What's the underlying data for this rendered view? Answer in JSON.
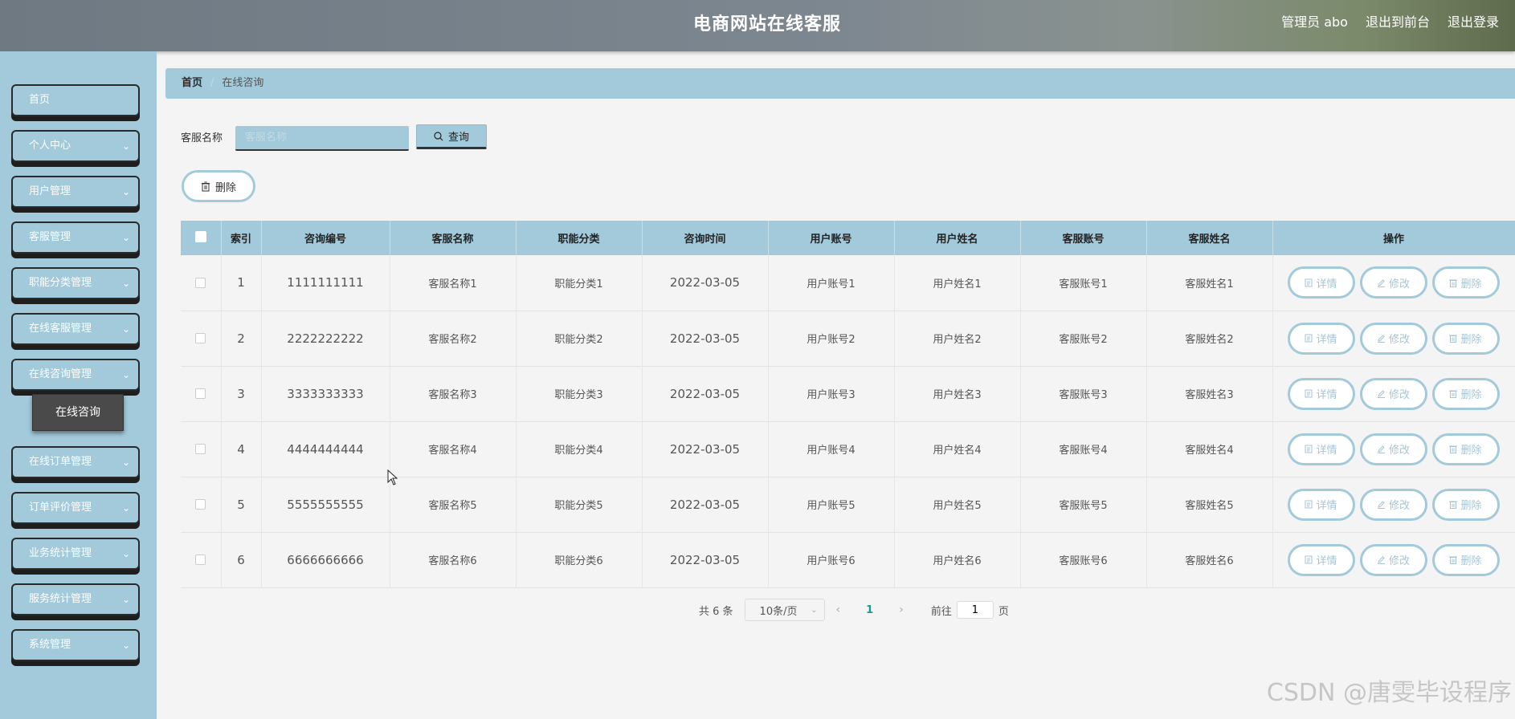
{
  "header": {
    "title": "电商网站在线客服",
    "admin": "管理员 abo",
    "front": "退出到前台",
    "logout": "退出登录"
  },
  "sidebar": {
    "items": [
      {
        "label": "首页",
        "chevron": false
      },
      {
        "label": "个人中心",
        "chevron": true
      },
      {
        "label": "用户管理",
        "chevron": true
      },
      {
        "label": "客服管理",
        "chevron": true
      },
      {
        "label": "职能分类管理",
        "chevron": true
      },
      {
        "label": "在线客服管理",
        "chevron": true
      },
      {
        "label": "在线咨询管理",
        "chevron": true
      },
      {
        "label": "在线订单管理",
        "chevron": true
      },
      {
        "label": "订单评价管理",
        "chevron": true
      },
      {
        "label": "业务统计管理",
        "chevron": true
      },
      {
        "label": "服务统计管理",
        "chevron": true
      },
      {
        "label": "系统管理",
        "chevron": true
      }
    ],
    "active_sub": "在线咨询"
  },
  "breadcrumb": {
    "home": "首页",
    "sep": "/",
    "current": "在线咨询"
  },
  "search": {
    "label": "客服名称",
    "placeholder": "客服名称",
    "button": "查询"
  },
  "toolbar": {
    "delete": "删除"
  },
  "table": {
    "headers": [
      "索引",
      "咨询编号",
      "客服名称",
      "职能分类",
      "咨询时间",
      "用户账号",
      "用户姓名",
      "客服账号",
      "客服姓名",
      "操作"
    ],
    "rows": [
      [
        "1",
        "1111111111",
        "客服名称1",
        "职能分类1",
        "2022-03-05",
        "用户账号1",
        "用户姓名1",
        "客服账号1",
        "客服姓名1"
      ],
      [
        "2",
        "2222222222",
        "客服名称2",
        "职能分类2",
        "2022-03-05",
        "用户账号2",
        "用户姓名2",
        "客服账号2",
        "客服姓名2"
      ],
      [
        "3",
        "3333333333",
        "客服名称3",
        "职能分类3",
        "2022-03-05",
        "用户账号3",
        "用户姓名3",
        "客服账号3",
        "客服姓名3"
      ],
      [
        "4",
        "4444444444",
        "客服名称4",
        "职能分类4",
        "2022-03-05",
        "用户账号4",
        "用户姓名4",
        "客服账号4",
        "客服姓名4"
      ],
      [
        "5",
        "5555555555",
        "客服名称5",
        "职能分类5",
        "2022-03-05",
        "用户账号5",
        "用户姓名5",
        "客服账号5",
        "客服姓名5"
      ],
      [
        "6",
        "6666666666",
        "客服名称6",
        "职能分类6",
        "2022-03-05",
        "用户账号6",
        "用户姓名6",
        "客服账号6",
        "客服姓名6"
      ]
    ],
    "actions": {
      "detail": "详情",
      "edit": "修改",
      "delete": "删除"
    }
  },
  "pagination": {
    "total": "共 6 条",
    "page_size": "10条/页",
    "current_page": "1",
    "goto_prefix": "前往",
    "goto_value": "1",
    "goto_suffix": "页"
  },
  "watermark": "CSDN @唐雯毕设程序"
}
